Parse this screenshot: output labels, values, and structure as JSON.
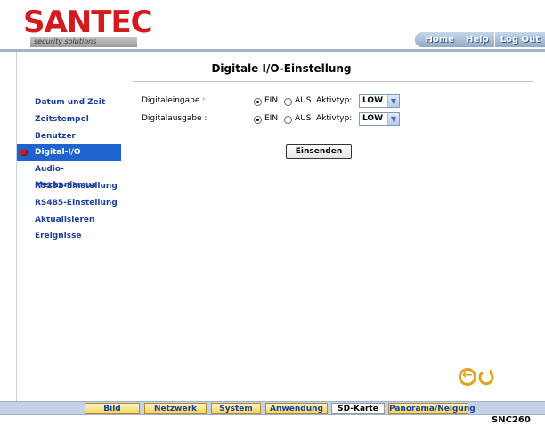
{
  "brand": {
    "logo": "SANTEC",
    "tagline": "security solutions",
    "model": "SNC260"
  },
  "topnav": [
    {
      "label": "Home"
    },
    {
      "label": "Help"
    },
    {
      "label": "Log Out"
    }
  ],
  "page": {
    "title": "Digitale I/O-Einstellung"
  },
  "sidebar": {
    "items": [
      {
        "label": "Datum und Zeit"
      },
      {
        "label": "Zeitstempel"
      },
      {
        "label": "Benutzer"
      },
      {
        "label": "Digital-I/O",
        "active": true
      },
      {
        "label": "Audio-Mechanismus"
      },
      {
        "label": "RS232-Einstellung"
      },
      {
        "label": "RS485-Einstellung"
      },
      {
        "label": "Aktualisieren"
      },
      {
        "label": "Ereignisse"
      }
    ]
  },
  "form": {
    "input": {
      "label": "Digitaleingabe :",
      "on_label": "EIN",
      "off_label": "AUS",
      "selected": "EIN",
      "type_label": "Aktivtyp:",
      "type_value": "LOW"
    },
    "output": {
      "label": "Digitalausgabe :",
      "on_label": "EIN",
      "off_label": "AUS",
      "selected": "EIN",
      "type_label": "Aktivtyp:",
      "type_value": "LOW"
    },
    "submit_label": "Einsenden"
  },
  "tabs": [
    {
      "label": "Bild"
    },
    {
      "label": "Netzwerk"
    },
    {
      "label": "System"
    },
    {
      "label": "Anwendung"
    },
    {
      "label": "SD-Karte",
      "active": true
    },
    {
      "label": "Panorama/Neigung"
    }
  ],
  "colors": {
    "brand_red": "#d31a1f",
    "link_blue": "#1b3e9a",
    "active_bg": "#1f63d0",
    "accent_orange": "#e0a31a"
  },
  "icons": {
    "back": "back-arrow-icon",
    "refresh": "refresh-icon"
  }
}
